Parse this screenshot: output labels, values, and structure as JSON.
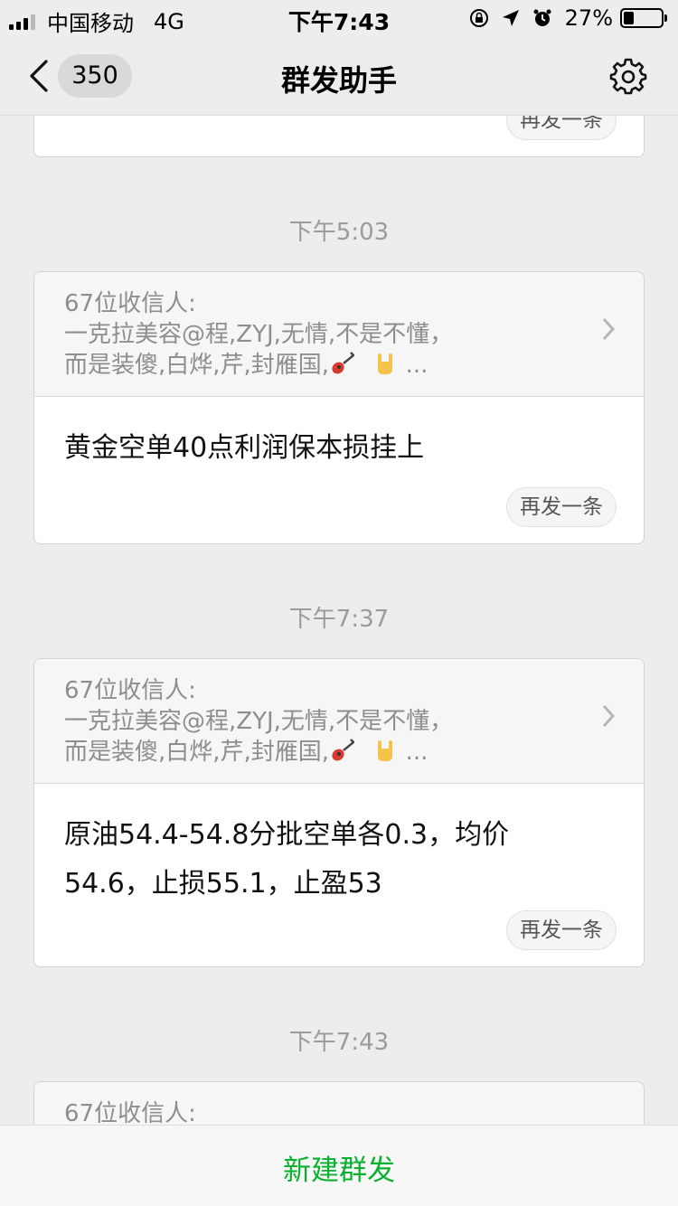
{
  "status": {
    "carrier": "中国移动",
    "network": "4G",
    "time": "下午7:43",
    "battery_text": "27%",
    "battery_level": 0.27
  },
  "nav": {
    "badge": "350",
    "title": "群发助手"
  },
  "cards": [
    {
      "resend_label": "再发一条"
    },
    {
      "timestamp": "下午5:03",
      "recipients_count": "67位收信人:",
      "recipients_line1": "一克拉美容@程,ZYJ,无情,不是不懂，",
      "recipients_line2": "而是装傻,白烨,芹,封雁国,",
      "ellipsis": "...",
      "message": "黄金空单40点利润保本损挂上",
      "resend_label": "再发一条"
    },
    {
      "timestamp": "下午7:37",
      "recipients_count": "67位收信人:",
      "recipients_line1": "一克拉美容@程,ZYJ,无情,不是不懂，",
      "recipients_line2": "而是装傻,白烨,芹,封雁国,",
      "ellipsis": "...",
      "message_line1": "原油54.4-54.8分批空单各0.3，均价",
      "message_line2": "54.6，止损55.1，止盈53",
      "resend_label": "再发一条"
    },
    {
      "timestamp": "下午7:43",
      "recipients_count": "67位收信人:"
    }
  ],
  "bottom": {
    "new_broadcast": "新建群发"
  },
  "colors": {
    "accent_green": "#09b12e",
    "background": "#ededed"
  }
}
